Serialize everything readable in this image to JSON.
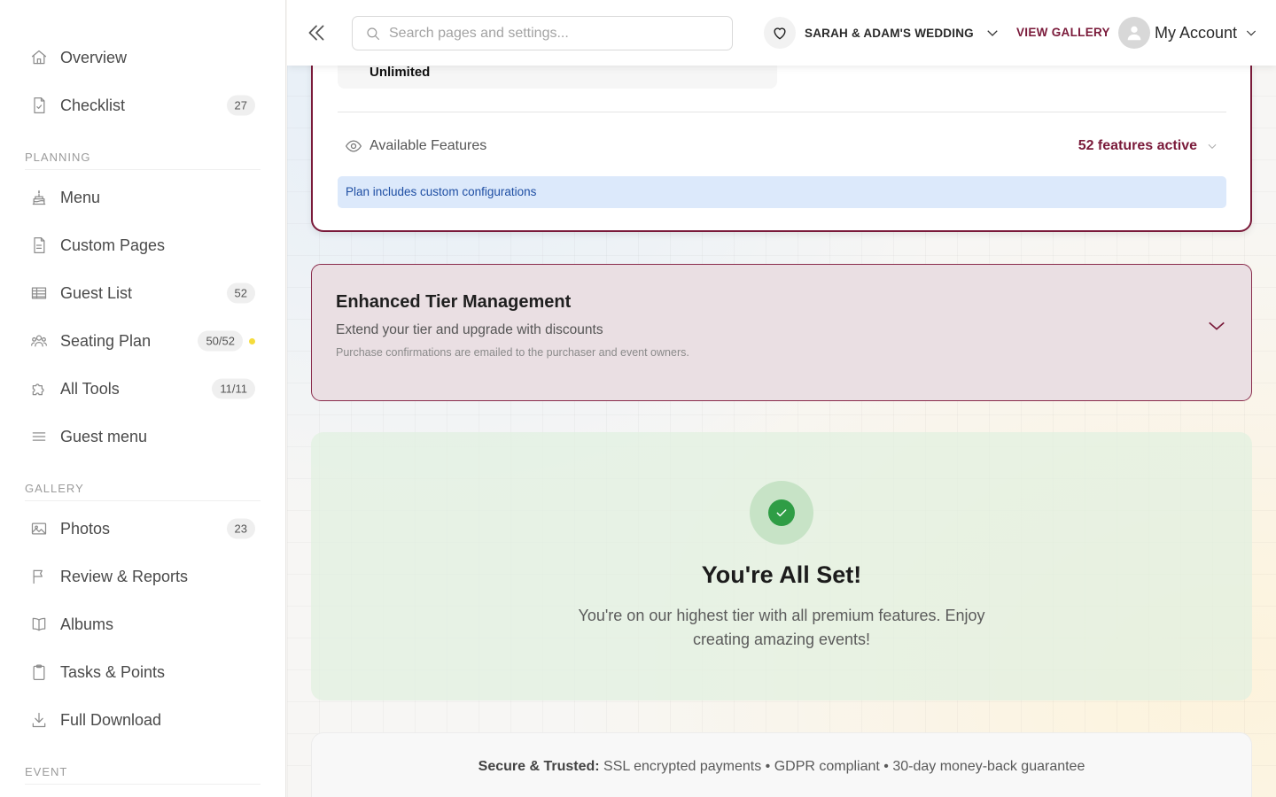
{
  "sidebar": {
    "items_top": [
      {
        "label": "Overview",
        "icon": "home-icon"
      },
      {
        "label": "Checklist",
        "icon": "checklist-icon",
        "badge": "27"
      }
    ],
    "sections": [
      {
        "title": "PLANNING",
        "items": [
          {
            "label": "Menu",
            "icon": "cake-icon"
          },
          {
            "label": "Custom Pages",
            "icon": "document-icon"
          },
          {
            "label": "Guest List",
            "icon": "table-icon",
            "badge": "52"
          },
          {
            "label": "Seating Plan",
            "icon": "people-icon",
            "badge": "50/52",
            "dot_color": "#f5dc3c"
          },
          {
            "label": "All Tools",
            "icon": "puzzle-icon",
            "badge": "11/11"
          },
          {
            "label": "Guest menu",
            "icon": "menu-lines-icon"
          }
        ]
      },
      {
        "title": "GALLERY",
        "items": [
          {
            "label": "Photos",
            "icon": "image-icon",
            "badge": "23"
          },
          {
            "label": "Review & Reports",
            "icon": "flag-icon"
          },
          {
            "label": "Albums",
            "icon": "book-icon"
          },
          {
            "label": "Tasks & Points",
            "icon": "clipboard-icon"
          },
          {
            "label": "Full Download",
            "icon": "download-icon"
          }
        ]
      },
      {
        "title": "EVENT",
        "items": []
      }
    ]
  },
  "topbar": {
    "search_placeholder": "Search pages and settings...",
    "event_name": "SARAH & ADAM'S WEDDING",
    "view_gallery": "VIEW GALLERY",
    "account_label": "My Account"
  },
  "plan_card": {
    "limit_value": "Unlimited",
    "features_label": "Available Features",
    "features_count": "52 features active",
    "note": "Plan includes custom configurations"
  },
  "tier_card": {
    "title": "Enhanced Tier Management",
    "subtitle": "Extend your tier and upgrade with discounts",
    "small_text": "Purchase confirmations are emailed to the purchaser and event owners."
  },
  "all_set": {
    "title": "You're All Set!",
    "text": "You're on our highest tier with all premium features. Enjoy creating amazing events!"
  },
  "secure": {
    "strong": "Secure & Trusted:",
    "text": " SSL encrypted payments • GDPR compliant • 30-day money-back guarantee"
  },
  "colors": {
    "accent": "#7a1a3a",
    "note_bg": "#dce9fb",
    "success": "#2f9d45"
  }
}
